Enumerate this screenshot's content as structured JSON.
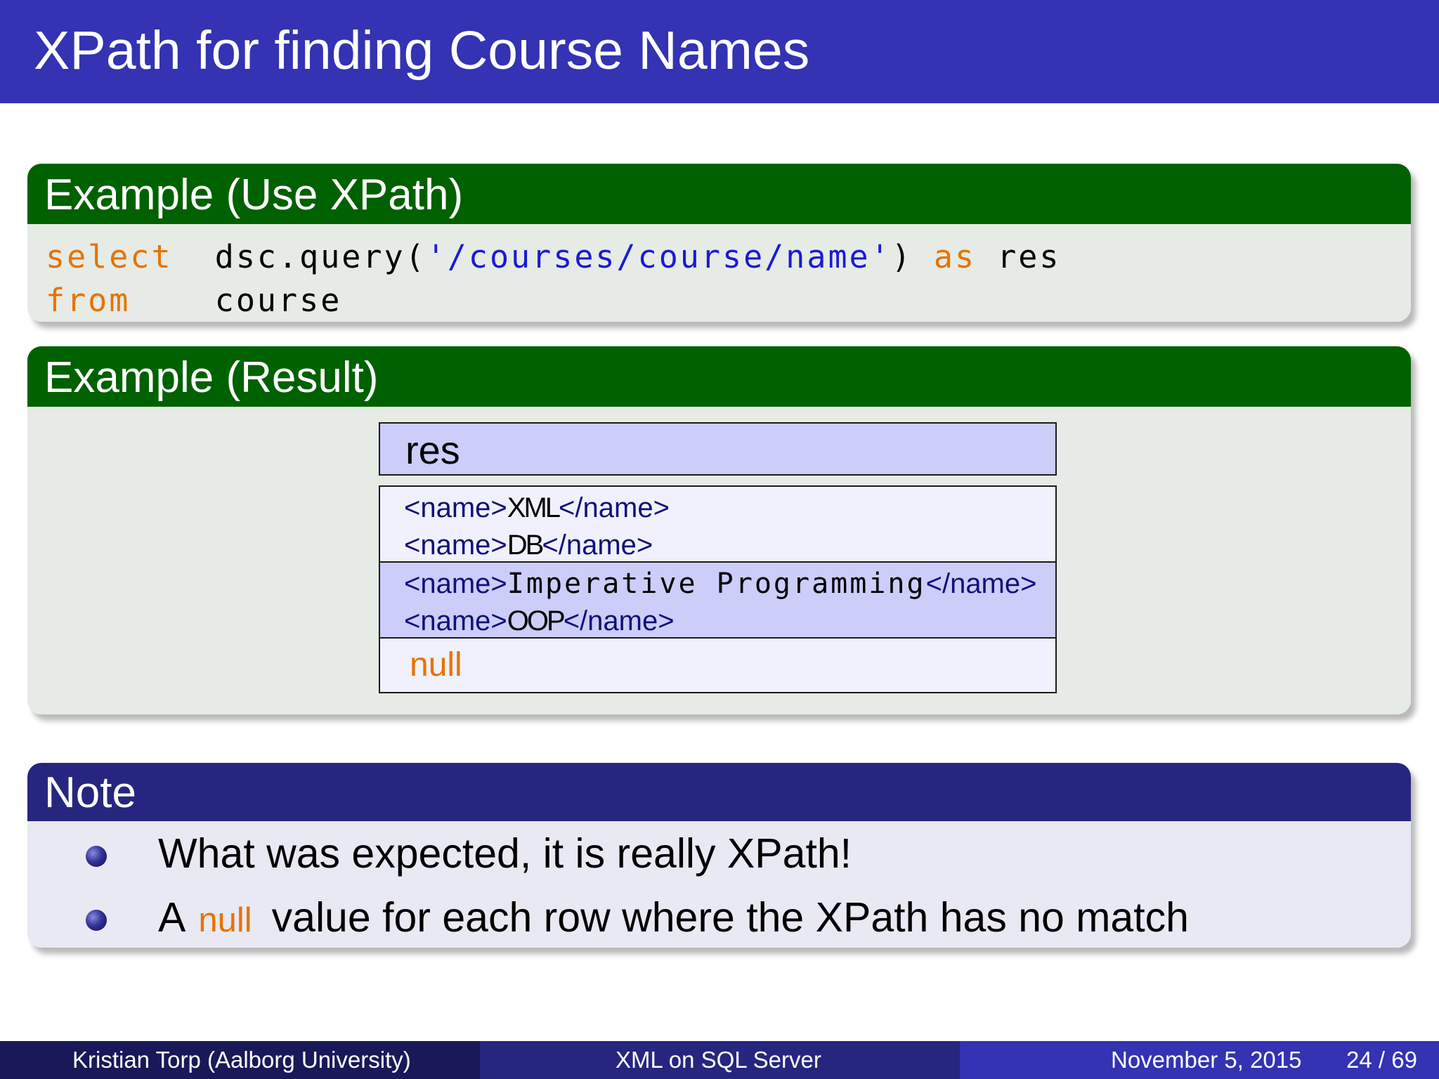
{
  "slide": {
    "title": "XPath for finding Course Names"
  },
  "blocks": {
    "use_xpath": {
      "header": "Example (Use XPath)",
      "code": {
        "line1": {
          "kw_select": "select",
          "expr_prefix": "dsc.query(",
          "string_literal": "'/courses/course/name'",
          "expr_suffix": ")",
          "kw_as": "as",
          "alias": "res"
        },
        "line2": {
          "kw_from": "from",
          "table": "course"
        }
      }
    },
    "result": {
      "header": "Example (Result)",
      "table": {
        "column": "res",
        "rows": [
          {
            "lines": [
              {
                "open": "<name>",
                "text": "XML",
                "close": "</name>"
              },
              {
                "open": "<name>",
                "text": "DB",
                "close": "</name>"
              }
            ]
          },
          {
            "lines": [
              {
                "open": "<name>",
                "text": "Imperative Programming",
                "close": "</name>"
              },
              {
                "open": "<name>",
                "text": "OOP",
                "close": "</name>"
              }
            ]
          },
          {
            "null_value": "null"
          }
        ]
      }
    },
    "note": {
      "header": "Note",
      "items": [
        {
          "text": "What was expected, it is really XPath!"
        },
        {
          "prefix": "A",
          "null_word": "null",
          "suffix": "value for each row where the XPath has no match"
        }
      ]
    }
  },
  "footer": {
    "author": "Kristian Torp  (Aalborg University)",
    "presentation_title": "XML on SQL Server",
    "date": "November 5, 2015",
    "page": "24 / 69"
  },
  "colors": {
    "title_bar": "#3333b3",
    "example_header": "#006100",
    "example_body": "#e6ebe6",
    "note_header": "#262680",
    "note_body": "#e9e9f3",
    "keyword": "#e67300",
    "string_literal": "#1a1ad6",
    "table_header_fill": "#cccdf9"
  }
}
